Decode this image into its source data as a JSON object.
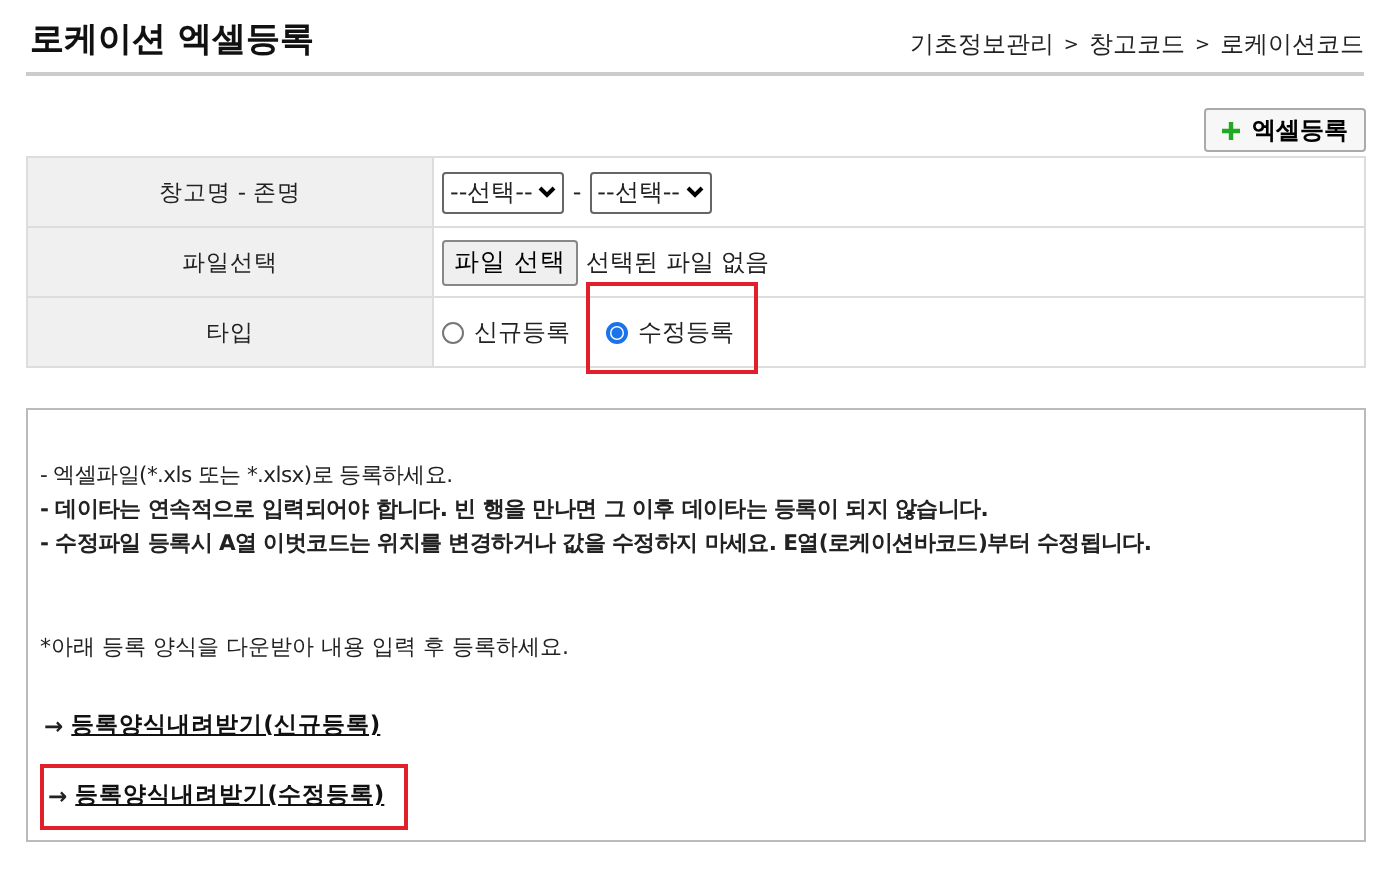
{
  "header": {
    "title": "로케이션 엑셀등록",
    "breadcrumb": [
      "기초정보관리",
      ">",
      "창고코드",
      ">",
      "로케이션코드"
    ]
  },
  "toolbar": {
    "add_button": "엑셀등록"
  },
  "form": {
    "rows": [
      {
        "kind": "selects",
        "label": "창고명 - 존명",
        "selects": [
          "--선택--",
          "--선택--"
        ],
        "separator": "-"
      },
      {
        "kind": "file",
        "label": "파일선택",
        "button": "파일 선택",
        "status": "선택된 파일 없음"
      },
      {
        "kind": "radios",
        "label": "타입",
        "options": [
          {
            "label": "신규등록",
            "selected": false,
            "highlighted": false
          },
          {
            "label": "수정등록",
            "selected": true,
            "highlighted": true
          }
        ]
      }
    ]
  },
  "notice": {
    "lines": [
      {
        "text": "- 엑셀파일(*.xls 또는 *.xlsx)로 등록하세요.",
        "bold": false
      },
      {
        "text": "- 데이타는 연속적으로 입력되어야 합니다. 빈 행을 만나면 그 이후 데이타는 등록이 되지 않습니다.",
        "bold": true
      },
      {
        "text": "- 수정파일 등록시 A열 이벗코드는 위치를 변경하거나 값을 수정하지 마세요. E열(로케이션바코드)부터 수정됩니다.",
        "bold": true
      }
    ],
    "hint": "*아래 등록 양식을 다운받아 내용 입력 후 등록하세요.",
    "links": [
      {
        "arrow": "→",
        "label": "등록양식내려받기(신규등록)",
        "highlighted": false
      },
      {
        "arrow": "→",
        "label": "등록양식내려받기(수정등록)",
        "highlighted": true
      }
    ]
  }
}
